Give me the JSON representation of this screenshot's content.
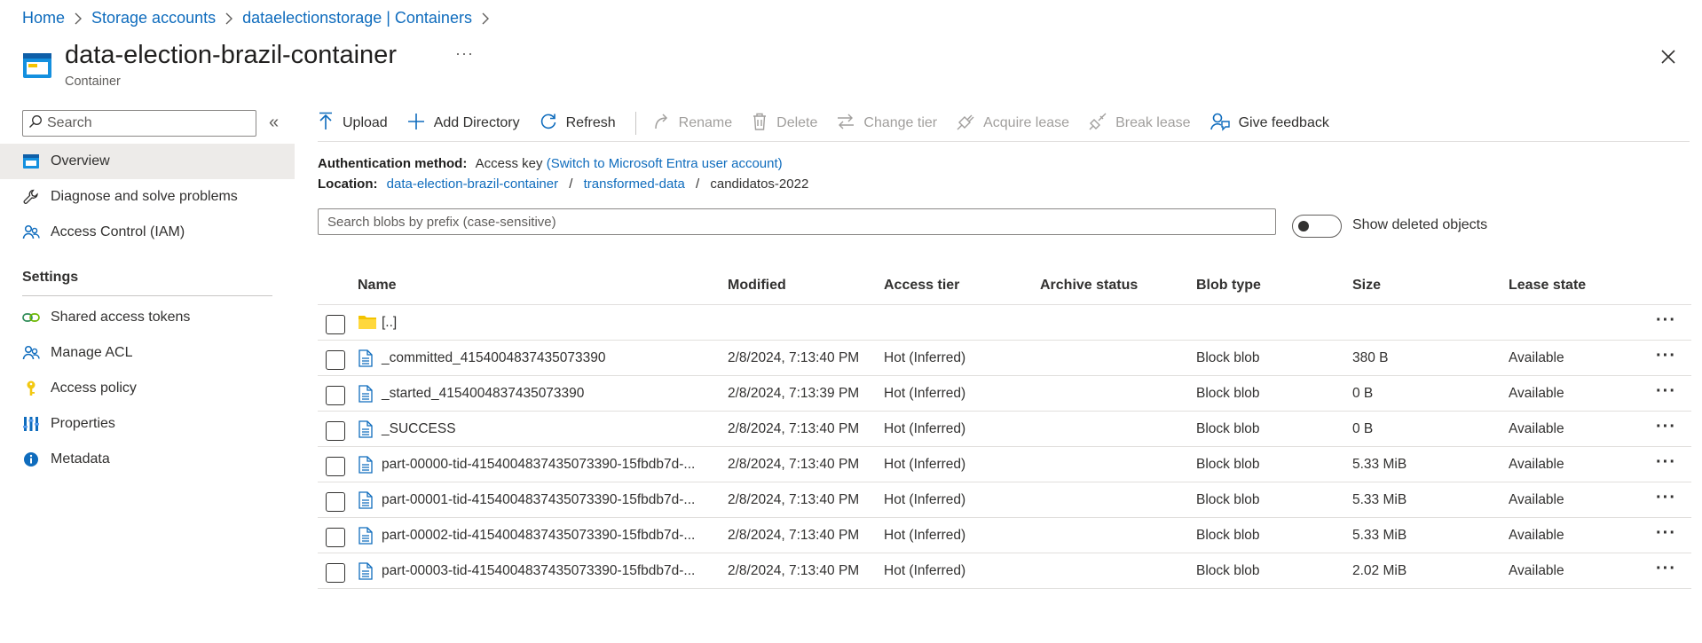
{
  "breadcrumb": {
    "items": [
      "Home",
      "Storage accounts",
      "dataelectionstorage | Containers"
    ]
  },
  "header": {
    "title": "data-election-brazil-container",
    "subtitle": "Container",
    "more": "···"
  },
  "sidebar": {
    "search_placeholder": "Search",
    "collapse": "«",
    "items": [
      {
        "label": "Overview",
        "icon": "overview-icon"
      },
      {
        "label": "Diagnose and solve problems",
        "icon": "wrench-icon"
      },
      {
        "label": "Access Control (IAM)",
        "icon": "people-icon"
      }
    ],
    "section": "Settings",
    "settings_items": [
      {
        "label": "Shared access tokens",
        "icon": "link-icon"
      },
      {
        "label": "Manage ACL",
        "icon": "people-icon"
      },
      {
        "label": "Access policy",
        "icon": "key-icon"
      },
      {
        "label": "Properties",
        "icon": "properties-icon"
      },
      {
        "label": "Metadata",
        "icon": "info-icon"
      }
    ]
  },
  "toolbar": {
    "upload": "Upload",
    "add_directory": "Add Directory",
    "refresh": "Refresh",
    "rename": "Rename",
    "delete": "Delete",
    "change_tier": "Change tier",
    "acquire_lease": "Acquire lease",
    "break_lease": "Break lease",
    "give_feedback": "Give feedback"
  },
  "info": {
    "auth_label": "Authentication method:",
    "auth_value": "Access key",
    "auth_link": "(Switch to Microsoft Entra user account)",
    "location_label": "Location:",
    "location_parts": [
      "data-election-brazil-container",
      "transformed-data",
      "candidatos-2022"
    ],
    "separator": "/"
  },
  "blob_search": {
    "placeholder": "Search blobs by prefix (case-sensitive)"
  },
  "toggle": {
    "label": "Show deleted objects",
    "on": false
  },
  "table": {
    "columns": [
      "Name",
      "Modified",
      "Access tier",
      "Archive status",
      "Blob type",
      "Size",
      "Lease state"
    ],
    "rows": [
      {
        "type": "folder",
        "name": "[..]",
        "modified": "",
        "tier": "",
        "archive": "",
        "blob_type": "",
        "size": "",
        "lease": ""
      },
      {
        "type": "file",
        "name": "_committed_4154004837435073390",
        "modified": "2/8/2024, 7:13:40 PM",
        "tier": "Hot (Inferred)",
        "archive": "",
        "blob_type": "Block blob",
        "size": "380 B",
        "lease": "Available"
      },
      {
        "type": "file",
        "name": "_started_4154004837435073390",
        "modified": "2/8/2024, 7:13:39 PM",
        "tier": "Hot (Inferred)",
        "archive": "",
        "blob_type": "Block blob",
        "size": "0 B",
        "lease": "Available"
      },
      {
        "type": "file",
        "name": "_SUCCESS",
        "modified": "2/8/2024, 7:13:40 PM",
        "tier": "Hot (Inferred)",
        "archive": "",
        "blob_type": "Block blob",
        "size": "0 B",
        "lease": "Available"
      },
      {
        "type": "file",
        "name": "part-00000-tid-4154004837435073390-15fbdb7d-...",
        "modified": "2/8/2024, 7:13:40 PM",
        "tier": "Hot (Inferred)",
        "archive": "",
        "blob_type": "Block blob",
        "size": "5.33 MiB",
        "lease": "Available"
      },
      {
        "type": "file",
        "name": "part-00001-tid-4154004837435073390-15fbdb7d-...",
        "modified": "2/8/2024, 7:13:40 PM",
        "tier": "Hot (Inferred)",
        "archive": "",
        "blob_type": "Block blob",
        "size": "5.33 MiB",
        "lease": "Available"
      },
      {
        "type": "file",
        "name": "part-00002-tid-4154004837435073390-15fbdb7d-...",
        "modified": "2/8/2024, 7:13:40 PM",
        "tier": "Hot (Inferred)",
        "archive": "",
        "blob_type": "Block blob",
        "size": "5.33 MiB",
        "lease": "Available"
      },
      {
        "type": "file",
        "name": "part-00003-tid-4154004837435073390-15fbdb7d-...",
        "modified": "2/8/2024, 7:13:40 PM",
        "tier": "Hot (Inferred)",
        "archive": "",
        "blob_type": "Block blob",
        "size": "2.02 MiB",
        "lease": "Available"
      }
    ],
    "row_more": "···"
  },
  "colors": {
    "link": "#0f6cbd",
    "folder": "#f3c300",
    "selected_nav": "#edebe9"
  }
}
